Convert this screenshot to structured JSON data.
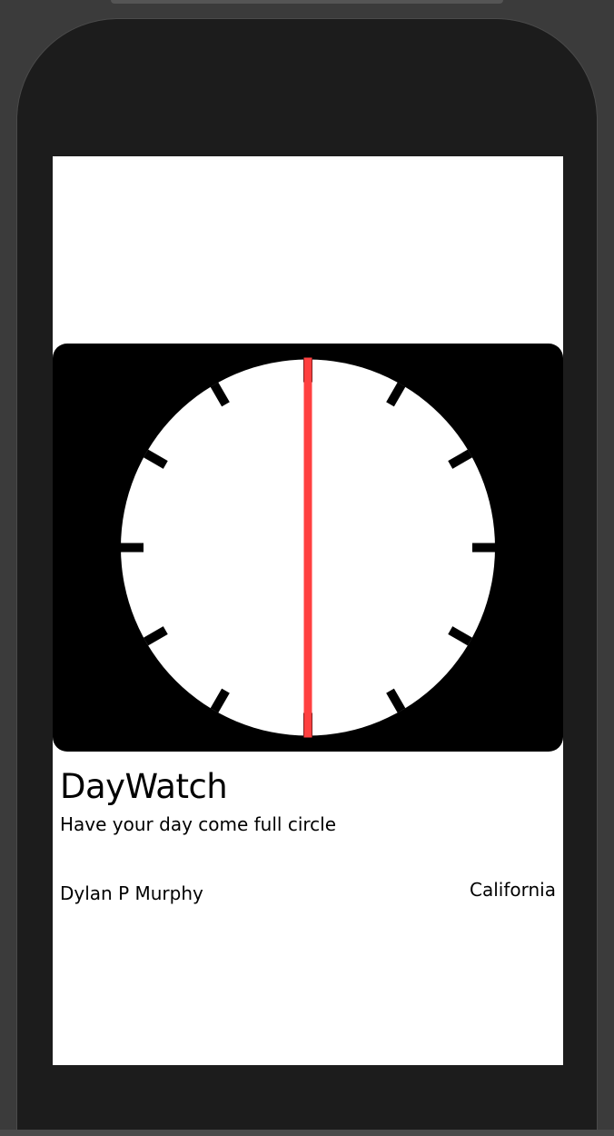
{
  "app": {
    "title": "DayWatch",
    "subtitle": "Have your day come full circle",
    "author": "Dylan P Murphy",
    "location": "California"
  },
  "clock": {
    "hand_angle_degrees": 0,
    "tick_count": 12,
    "colors": {
      "card_background": "#000000",
      "dial_face": "#ffffff",
      "tick_marks": "#000000",
      "hand": "#ff4040"
    }
  },
  "colors": {
    "screen_background": "#ffffff",
    "device_frame": "#1c1c1c",
    "text": "#000000"
  }
}
